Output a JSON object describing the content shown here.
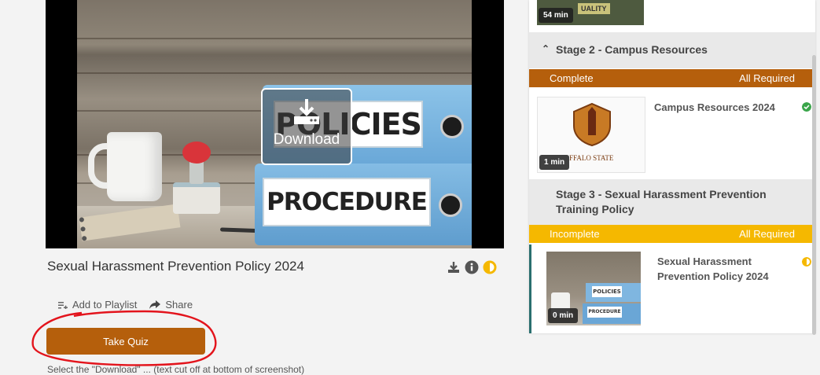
{
  "player": {
    "overlay_download_label": "Download",
    "binder_label_top": "POLICIES",
    "binder_label_bottom": "PROCEDURE"
  },
  "video_title": "Sexual Harassment Prevention Policy 2024",
  "title_icons": [
    "download-icon",
    "info-icon",
    "half-circle-status-icon"
  ],
  "actions": {
    "add_to_playlist": "Add to Playlist",
    "share": "Share"
  },
  "take_quiz_label": "Take Quiz",
  "cut_off_text": "Select the \"Download\" ... (text cut off at bottom of screenshot)",
  "sidebar": {
    "stage1_item": {
      "duration": "54 min",
      "thumb_text": "UALITY"
    },
    "stage2": {
      "title": "Stage 2 - Campus Resources",
      "status": "Complete",
      "requirement": "All Required",
      "status_color": "#b55f0c",
      "item": {
        "title": "Campus Resources 2024",
        "duration": "1 min",
        "thumb_text": "FFALO STATE"
      }
    },
    "stage3": {
      "title": "Stage 3 - Sexual Harassment Prevention Training Policy",
      "status": "Incomplete",
      "requirement": "All Required",
      "status_color": "#f5b800",
      "item": {
        "title": "Sexual Harassment Prevention Policy 2024",
        "duration": "0 min",
        "thumb_label_top": "POLICIES",
        "thumb_label_bottom": "PROCEDURE"
      }
    }
  },
  "colors": {
    "accent_orange": "#b55f0c",
    "yellow": "#f5b800",
    "complete_green": "#3aa54a"
  }
}
